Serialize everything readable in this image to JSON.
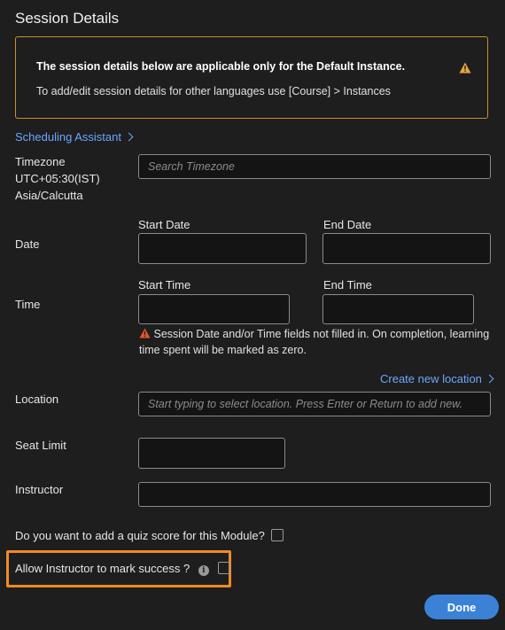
{
  "panel": {
    "title": "Session Details"
  },
  "notice": {
    "heading": "The session details below are applicable only for the Default Instance.",
    "text": "To add/edit session details for other languages use [Course] > Instances"
  },
  "scheduling": {
    "label": "Scheduling Assistant"
  },
  "timezone": {
    "label": "Timezone",
    "offset": "UTC+05:30(IST)",
    "region": "Asia/Calcutta",
    "placeholder": "Search Timezone"
  },
  "date": {
    "label": "Date",
    "start_label": "Start Date",
    "end_label": "End Date"
  },
  "time": {
    "label": "Time",
    "start_label": "Start Time",
    "end_label": "End Time",
    "warning": "Session Date and/or Time fields not filled in. On completion, learning time spent will be marked as zero."
  },
  "location": {
    "label": "Location",
    "create_link": "Create new location",
    "placeholder": "Start typing to select location. Press Enter or Return to add new."
  },
  "seat_limit": {
    "label": "Seat Limit"
  },
  "instructor": {
    "label": "Instructor"
  },
  "quiz": {
    "label": "Do you want to add a quiz score for this Module?",
    "checked": false
  },
  "mark_success": {
    "label": "Allow Instructor to mark success ?",
    "info_glyph": "i",
    "checked": false
  },
  "footer": {
    "done_label": "Done"
  },
  "colors": {
    "accent": "#3b82d6",
    "link": "#6aa7ff",
    "warning": "#e8a33d",
    "highlight": "#f08a24"
  }
}
